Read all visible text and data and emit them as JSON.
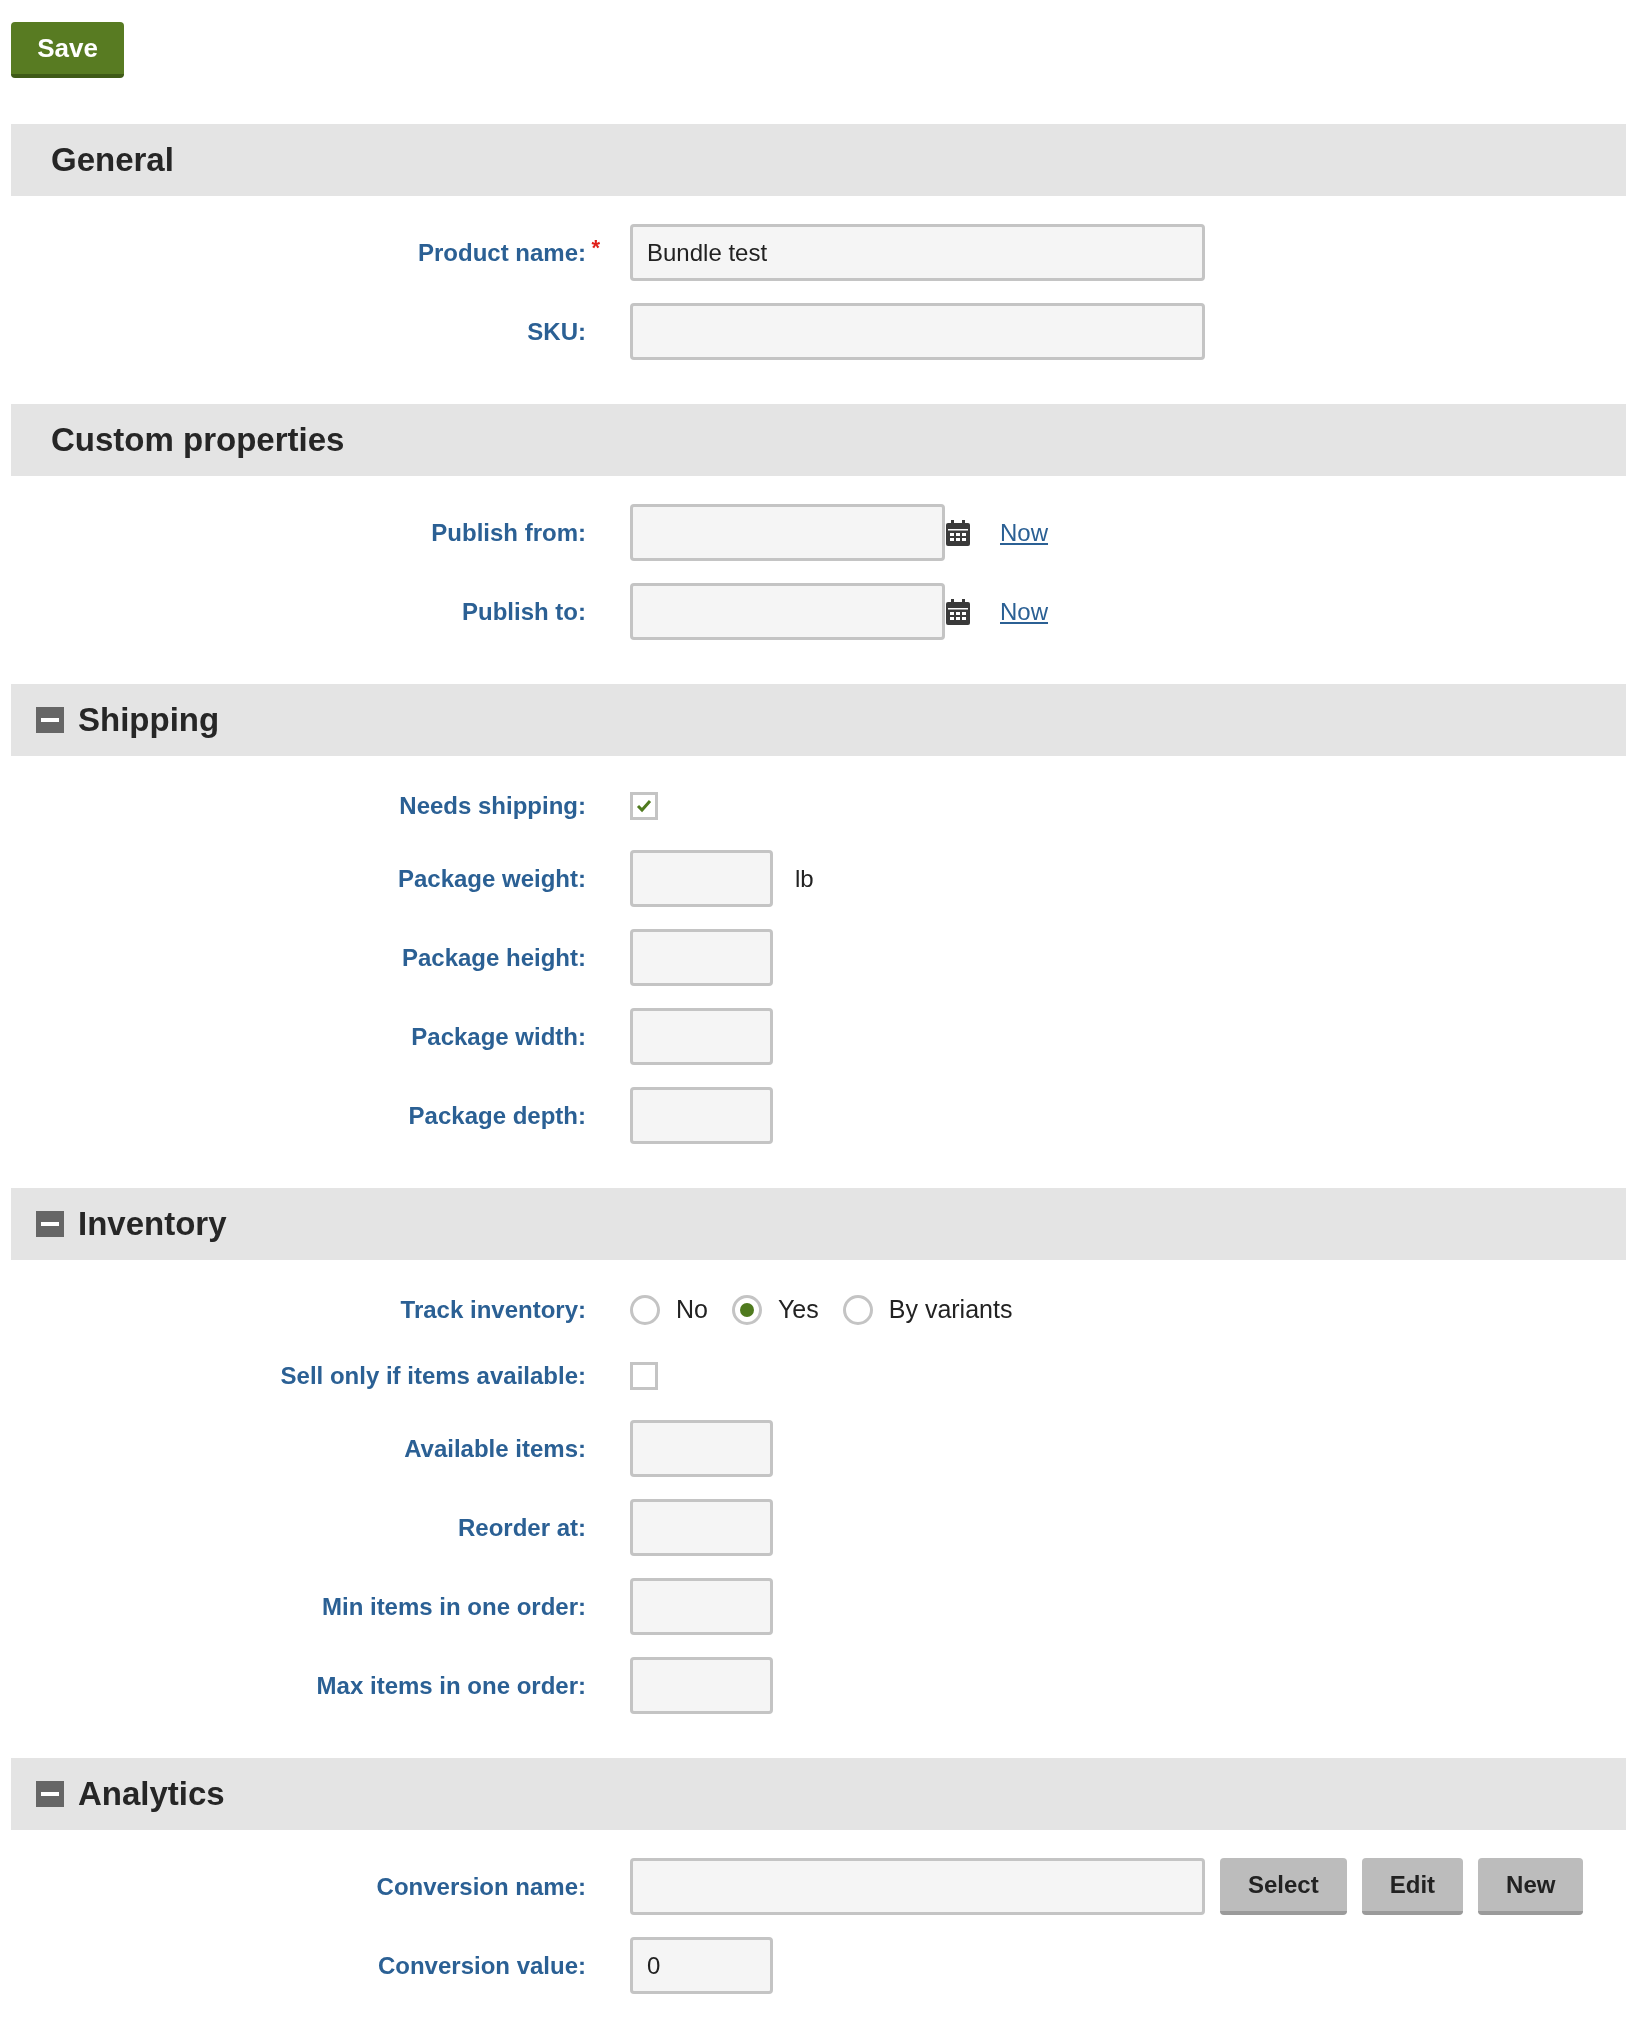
{
  "save_button": "Save",
  "sections": [
    {
      "title": "General",
      "fields": [
        {
          "kind": "text",
          "label": "Product name:",
          "required_mark": "*",
          "value": "Bundle test"
        },
        {
          "kind": "text",
          "label": "SKU:"
        }
      ]
    },
    {
      "title": "Custom properties",
      "fields": [
        {
          "kind": "date",
          "label": "Publish from:",
          "link": "Now"
        },
        {
          "kind": "date",
          "label": "Publish to:",
          "link": "Now"
        }
      ]
    },
    {
      "title": "Shipping",
      "expanded": true,
      "fields": [
        {
          "kind": "checkbox",
          "label": "Needs shipping:",
          "checked": true
        },
        {
          "kind": "number",
          "label": "Package weight:",
          "unit": "lb"
        },
        {
          "kind": "number",
          "label": "Package height:"
        },
        {
          "kind": "number",
          "label": "Package width:"
        },
        {
          "kind": "number",
          "label": "Package depth:"
        }
      ]
    },
    {
      "title": "Inventory",
      "expanded": true,
      "fields": [
        {
          "kind": "radio",
          "label": "Track inventory:",
          "options": [
            {
              "label": "No",
              "selected": false
            },
            {
              "label": "Yes",
              "selected": true
            },
            {
              "label": "By variants",
              "selected": false
            }
          ]
        },
        {
          "kind": "checkbox",
          "label": "Sell only if items available:",
          "checked": false
        },
        {
          "kind": "number",
          "label": "Available items:"
        },
        {
          "kind": "number",
          "label": "Reorder at:"
        },
        {
          "kind": "number",
          "label": "Min items in one order:"
        },
        {
          "kind": "number",
          "label": "Max items in one order:"
        }
      ]
    },
    {
      "title": "Analytics",
      "expanded": true,
      "fields": [
        {
          "kind": "picker",
          "label": "Conversion name:",
          "buttons": [
            "Select",
            "Edit",
            "New"
          ]
        },
        {
          "kind": "number",
          "label": "Conversion value:",
          "value": "0"
        }
      ]
    }
  ]
}
